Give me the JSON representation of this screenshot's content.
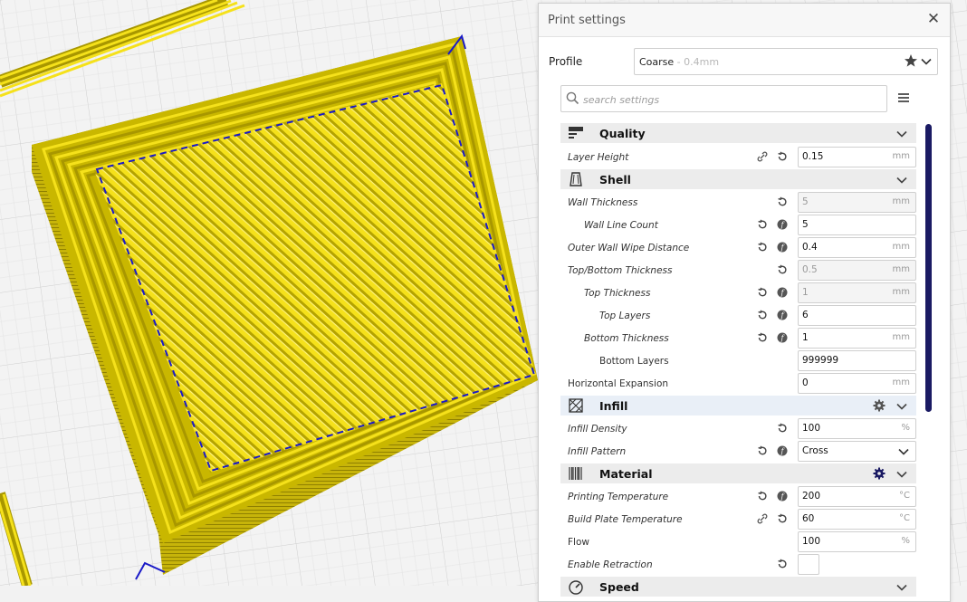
{
  "panel": {
    "title": "Print settings",
    "close_glyph": "✕",
    "profile_label": "Profile",
    "profile_value": "Coarse",
    "profile_sub": " - 0.4mm",
    "search_placeholder": "search settings"
  },
  "sections": {
    "quality": "Quality",
    "shell": "Shell",
    "infill": "Infill",
    "material": "Material",
    "speed": "Speed"
  },
  "settings": {
    "layer_height": {
      "label": "Layer Height",
      "value": "0.15",
      "unit": "mm"
    },
    "wall_thickness": {
      "label": "Wall Thickness",
      "value": "5",
      "unit": "mm"
    },
    "wall_line_count": {
      "label": "Wall Line Count",
      "value": "5"
    },
    "outer_wall_wipe": {
      "label": "Outer Wall Wipe Distance",
      "value": "0.4",
      "unit": "mm"
    },
    "top_bottom_thickness": {
      "label": "Top/Bottom Thickness",
      "value": "0.5",
      "unit": "mm"
    },
    "top_thickness": {
      "label": "Top Thickness",
      "value": "1",
      "unit": "mm"
    },
    "top_layers": {
      "label": "Top Layers",
      "value": "6"
    },
    "bottom_thickness": {
      "label": "Bottom Thickness",
      "value": "1",
      "unit": "mm"
    },
    "bottom_layers": {
      "label": "Bottom Layers",
      "value": "999999"
    },
    "horizontal_expansion": {
      "label": "Horizontal Expansion",
      "value": "0",
      "unit": "mm"
    },
    "infill_density": {
      "label": "Infill Density",
      "value": "100",
      "unit": "%"
    },
    "infill_pattern": {
      "label": "Infill Pattern",
      "value": "Cross"
    },
    "printing_temperature": {
      "label": "Printing Temperature",
      "value": "200",
      "unit": "°C"
    },
    "build_plate_temperature": {
      "label": "Build Plate Temperature",
      "value": "60",
      "unit": "°C"
    },
    "flow": {
      "label": "Flow",
      "value": "100",
      "unit": "%"
    },
    "enable_retraction": {
      "label": "Enable Retraction"
    }
  },
  "colors": {
    "model_yellow": "#f5e11b",
    "model_dark": "#a29200",
    "outline_blue": "#1a1ac8",
    "scrollbar": "#1a1a63"
  },
  "icons": [
    "close-icon",
    "star-icon",
    "chevron-down-icon",
    "search-icon",
    "hamburger-menu-icon",
    "quality-icon",
    "shell-icon",
    "infill-icon",
    "material-icon",
    "speed-icon",
    "link-icon",
    "reset-icon",
    "function-icon",
    "gear-icon"
  ]
}
